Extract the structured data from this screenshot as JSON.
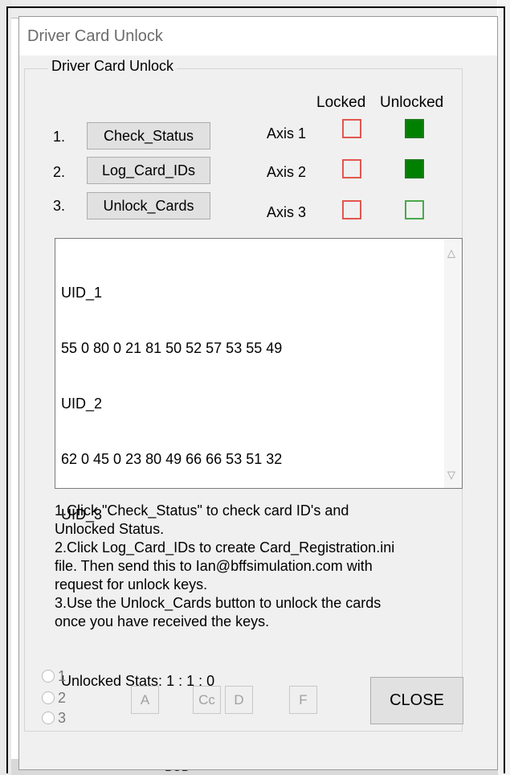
{
  "window": {
    "title": "Driver Card Unlock"
  },
  "group": {
    "legend": "Driver Card Unlock"
  },
  "headers": {
    "locked": "Locked",
    "unlocked": "Unlocked"
  },
  "rows": [
    {
      "number": "1.",
      "button": "Check_Status",
      "axis": "Axis 1",
      "locked": false,
      "unlocked": true
    },
    {
      "number": "2.",
      "button": "Log_Card_IDs",
      "axis": "Axis 2",
      "locked": false,
      "unlocked": true
    },
    {
      "number": "3.",
      "button": "Unlock_Cards",
      "axis": "Axis 3",
      "locked": false,
      "unlocked": false
    }
  ],
  "output_text": {
    "lines": [
      "UID_1",
      "55 0 80 0 21 81 50 52 57 53 55 49",
      "UID_2",
      "62 0 45 0 23 80 49 66 66 53 51 32",
      "UID_3",
      "",
      "",
      "Unlocked Stats: 1 : 1 : 0"
    ]
  },
  "instructions": [
    "1.Click \"Check_Status\" to check card ID's and",
    "Unlocked Status.",
    "2.Click Log_Card_IDs to create Card_Registration.ini",
    "file. Then send this to Ian@bffsimulation.com with",
    "request for unlock keys.",
    "3.Use the Unlock_Cards button to unlock the cards",
    "once you have received the keys."
  ],
  "radios": [
    "1",
    "2",
    "3"
  ],
  "small_buttons": {
    "a": "A",
    "cc": "Cc",
    "d": "D",
    "f": "F"
  },
  "close_button": "CLOSE",
  "background": {
    "bottom_text": "BUD"
  },
  "colors": {
    "unlocked_on": "#008000",
    "locked_border": "#e2564f",
    "unlocked_off_border": "#4ca84c"
  }
}
